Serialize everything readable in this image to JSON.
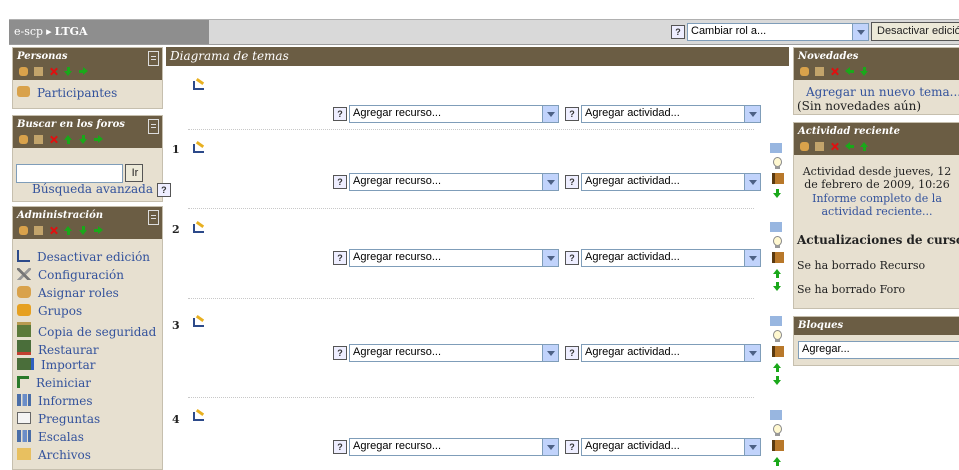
{
  "navbar": {
    "crumb_site": "e-scp",
    "crumb_sep": "▸",
    "crumb_course": "LTGA",
    "role_select": "Cambiar rol a...",
    "edit_button": "Desactivar edición"
  },
  "personas": {
    "title": "Personas",
    "participants": "Participantes"
  },
  "foros": {
    "title": "Buscar en los foros",
    "search_value": "",
    "go_button": "Ir",
    "advanced": "Búsqueda avanzada"
  },
  "admin": {
    "title": "Administración",
    "items": [
      {
        "label": "Desactivar edición",
        "icon": "edit-icon"
      },
      {
        "label": "Configuración",
        "icon": "settings-icon"
      },
      {
        "label": "Asignar roles",
        "icon": "roles-icon"
      },
      {
        "label": "Grupos",
        "icon": "groups-icon"
      },
      {
        "label": "Copia de seguridad",
        "icon": "backup-icon"
      },
      {
        "label": "Restaurar",
        "icon": "restore-icon"
      },
      {
        "label": "Importar",
        "icon": "import-icon"
      },
      {
        "label": "Reiniciar",
        "icon": "reset-icon"
      },
      {
        "label": "Informes",
        "icon": "reports-icon"
      },
      {
        "label": "Preguntas",
        "icon": "questions-icon"
      },
      {
        "label": "Escalas",
        "icon": "scales-icon"
      },
      {
        "label": "Archivos",
        "icon": "files-icon"
      }
    ]
  },
  "main": {
    "title": "Diagrama de temas",
    "resource_select": "Agregar recurso...",
    "activity_select": "Agregar actividad...",
    "sections": [
      {
        "num": ""
      },
      {
        "num": "1"
      },
      {
        "num": "2"
      },
      {
        "num": "3"
      },
      {
        "num": "4"
      }
    ]
  },
  "novedades": {
    "title": "Novedades",
    "add_topic": "Agregar un nuevo tema...",
    "none": "(Sin novedades aún)"
  },
  "reciente": {
    "title": "Actividad reciente",
    "since": "Actividad desde jueves, 12 de febrero de 2009, 10:26",
    "full_report": "Informe completo de la actividad reciente...",
    "updates_title": "Actualizaciones de cursos:",
    "update1": "Se ha borrado Recurso",
    "update2": "Se ha borrado Foro"
  },
  "bloques": {
    "title": "Bloques",
    "add_select": "Agregar..."
  },
  "colors": {
    "block_header": "#6b5d44",
    "block_bg": "#e7e0d0",
    "link": "#33529c"
  }
}
